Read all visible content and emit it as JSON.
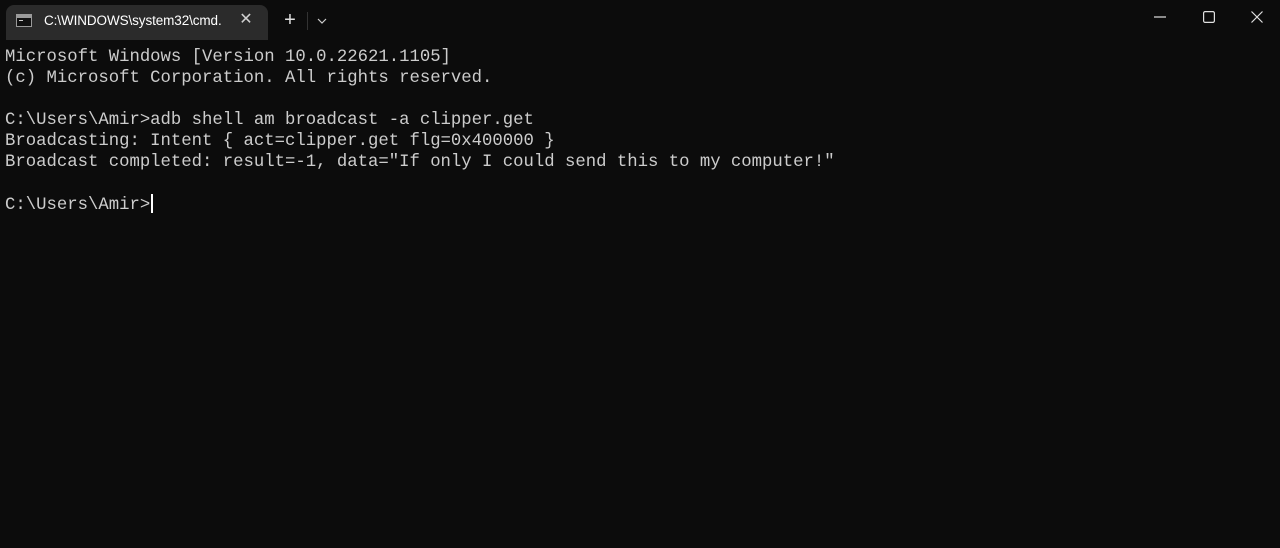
{
  "window": {
    "tab_title": "C:\\WINDOWS\\system32\\cmd.",
    "tab_close_glyph": "✕",
    "new_tab_glyph": "+",
    "icons": {
      "tab": "cmd-icon",
      "close_tab": "close-icon",
      "new_tab": "plus-icon",
      "dropdown": "chevron-down-icon",
      "minimize": "minimize-icon",
      "maximize": "maximize-icon",
      "close": "close-icon"
    }
  },
  "terminal": {
    "lines": [
      "Microsoft Windows [Version 10.0.22621.1105]",
      "(c) Microsoft Corporation. All rights reserved.",
      "",
      "C:\\Users\\Amir>adb shell am broadcast -a clipper.get",
      "Broadcasting: Intent { act=clipper.get flg=0x400000 }",
      "Broadcast completed: result=-1, data=\"If only I could send this to my computer!\"",
      "",
      "C:\\Users\\Amir>"
    ],
    "foreground": "#cccccc",
    "background": "#0c0c0c"
  }
}
